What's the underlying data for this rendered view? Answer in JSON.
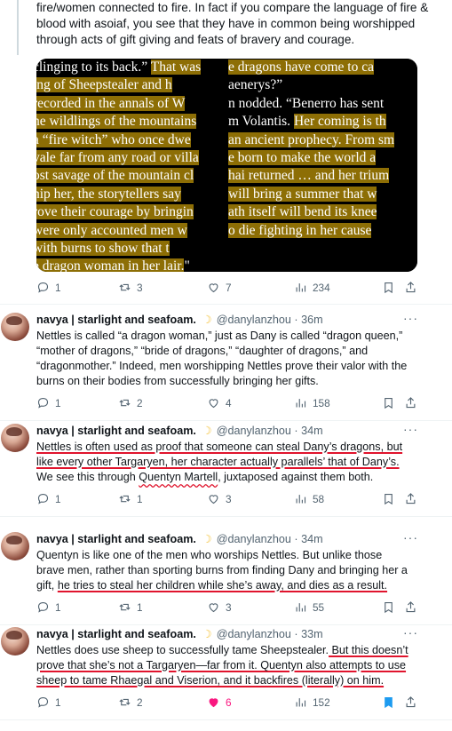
{
  "top_tweet": {
    "text_lines": [
      "fire/women connected to fire. In fact if you compare the language of fire &",
      "blood with asoiaf, you see that they have in common being worshipped",
      "through acts of gift giving and feats of bravery and courage."
    ],
    "media_left_lines": [
      {
        "pre": "clinging to its back.” ",
        "hl": "That was"
      },
      {
        "pre": "",
        "hl": "ing of Sheepstealer and h"
      },
      {
        "pre": "",
        "hl": "recorded in the annals of W"
      },
      {
        "pre": "",
        "hl": "he wildlings of the mountains"
      },
      {
        "pre": "",
        "hl": "a “fire witch” who once dwe"
      },
      {
        "pre": "",
        "hl": "vale far from any road or villa"
      },
      {
        "pre": "",
        "hl": "ost savage of the mountain cl"
      },
      {
        "pre": "",
        "hl": "hip her, the storytellers say"
      },
      {
        "pre": "",
        "hl": "rove their courage by bringin"
      },
      {
        "pre": "",
        "hl": " were only accounted men w"
      },
      {
        "pre": "",
        "hl": " with burns to show that t"
      },
      {
        "pre": "",
        "hl": "e dragon woman in her lair.",
        "post": "\""
      }
    ],
    "media_right_lines": [
      {
        "pre": "",
        "hl": "e dragons have come to ca"
      },
      {
        "pre": "aenerys?”",
        "hl": ""
      },
      {
        "pre": "n nodded. “Benerro has sent",
        "hl": ""
      },
      {
        "pre": "m Volantis. ",
        "hl": "Her coming is th"
      },
      {
        "pre": "",
        "hl": "an ancient prophecy. From sm"
      },
      {
        "pre": "",
        "hl": "e born to make the world a"
      },
      {
        "pre": "",
        "hl": "hai returned … and her trium"
      },
      {
        "pre": "",
        "hl": " will bring a summer that w"
      },
      {
        "pre": "",
        "hl": "ath itself will bend its knee"
      },
      {
        "pre": "",
        "hl": "o die fighting in her cause"
      }
    ],
    "stats": {
      "replies": "1",
      "reposts": "3",
      "likes": "7",
      "views": "234"
    }
  },
  "tweets": [
    {
      "name": "navya | starlight and seafoam.",
      "moon": "☽",
      "handle": "@danylanzhou",
      "dot": "·",
      "time": "36m",
      "lines": [
        [
          {
            "t": "Nettles is called “a dragon woman,” just as Dany is called “dragon queen,”"
          }
        ],
        [
          {
            "t": "“mother of dragons,” “bride of dragons,” “daughter of dragons,” and"
          }
        ],
        [
          {
            "t": "“dragonmother.” Indeed, men worshipping Nettles prove their valor with the"
          }
        ],
        [
          {
            "t": "burns on their bodies from successfully bringing her gifts."
          }
        ]
      ],
      "stats": {
        "replies": "1",
        "reposts": "2",
        "likes": "4",
        "views": "158"
      }
    },
    {
      "name": "navya | starlight and seafoam.",
      "moon": "☽",
      "handle": "@danylanzhou",
      "dot": "·",
      "time": "34m",
      "lines": [
        [
          {
            "t": "Nettles is often used as proof that someone can steal Dany’s dragons, but",
            "u": true
          }
        ],
        [
          {
            "t": "like every other Targaryen, her character actually parallels’ that of Dany’s.",
            "u": true
          }
        ],
        [
          {
            "t": "We see this through "
          },
          {
            "t": "Quentyn Martell",
            "s": true
          },
          {
            "t": ", juxtaposed against them both."
          }
        ]
      ],
      "stats": {
        "replies": "1",
        "reposts": "1",
        "likes": "3",
        "views": "58"
      }
    },
    {
      "name": "navya | starlight and seafoam.",
      "moon": "☽",
      "handle": "@danylanzhou",
      "dot": "·",
      "time": "34m",
      "lines": [
        [
          {
            "t": "Quentyn is like one of the men who worships Nettles. But unlike those"
          }
        ],
        [
          {
            "t": "brave men, rather than sporting burns from finding Dany and bringing her a"
          }
        ],
        [
          {
            "t": "gift, "
          },
          {
            "t": "he tries to steal her children while she’s away, and dies as a result.",
            "u": true
          }
        ]
      ],
      "stats": {
        "replies": "1",
        "reposts": "1",
        "likes": "3",
        "views": "55"
      }
    },
    {
      "name": "navya | starlight and seafoam.",
      "moon": "☽",
      "handle": "@danylanzhou",
      "dot": "·",
      "time": "33m",
      "lines": [
        [
          {
            "t": "Nettles does use sheep to successfully tame Sheepstealer."
          },
          {
            "t": " But this doesn’t",
            "u": true
          }
        ],
        [
          {
            "t": "prove that she’s not a Targaryen—far from it. Quentyn also attempts to use",
            "u": true
          }
        ],
        [
          {
            "t": "sheep to tame Rhaegal and Viserion, and it backfires (literally) on him.",
            "u": true
          }
        ]
      ],
      "stats": {
        "replies": "1",
        "reposts": "2",
        "likes": "6",
        "views": "152"
      },
      "liked": true,
      "bookmarked": true
    }
  ],
  "more_label": "···",
  "colors": {
    "accent": "#1d9bf0",
    "like": "#f91880",
    "highlight": "#8d6e05",
    "underline": "#e0142d",
    "muted": "#536471"
  }
}
